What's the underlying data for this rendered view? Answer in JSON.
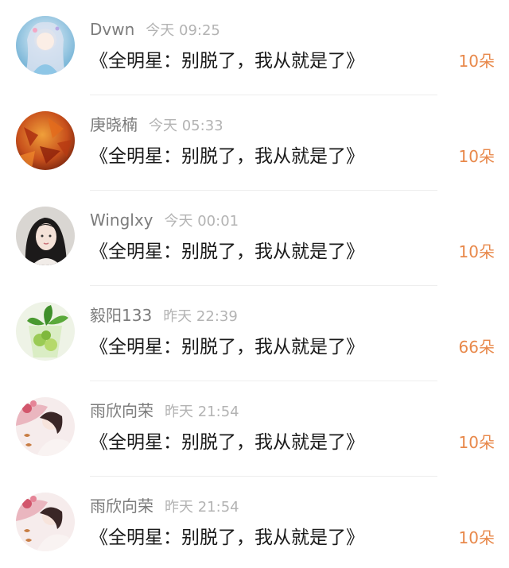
{
  "items": [
    {
      "username": "Dvwn",
      "time": "今天 09:25",
      "title": "《全明星：别脱了，我从就是了》",
      "count": "10朵",
      "avatar": "anime-girl-blue"
    },
    {
      "username": "庚晓楠",
      "time": "今天 05:33",
      "title": "《全明星：别脱了，我从就是了》",
      "count": "10朵",
      "avatar": "autumn-leaves"
    },
    {
      "username": "Winglxy",
      "time": "今天 00:01",
      "title": "《全明星：别脱了，我从就是了》",
      "count": "10朵",
      "avatar": "woman-portrait"
    },
    {
      "username": "毅阳133",
      "time": "昨天 22:39",
      "title": "《全明星：别脱了，我从就是了》",
      "count": "66朵",
      "avatar": "green-drink"
    },
    {
      "username": "雨欣向荣",
      "time": "昨天 21:54",
      "title": "《全明星：别脱了，我从就是了》",
      "count": "10朵",
      "avatar": "flower-girl"
    },
    {
      "username": "雨欣向荣",
      "time": "昨天 21:54",
      "title": "《全明星：别脱了，我从就是了》",
      "count": "10朵",
      "avatar": "flower-girl"
    }
  ],
  "colors": {
    "count": "#e8884a",
    "username": "#7c7c7c",
    "time": "#b3b3b3",
    "title": "#1a1a1a"
  }
}
